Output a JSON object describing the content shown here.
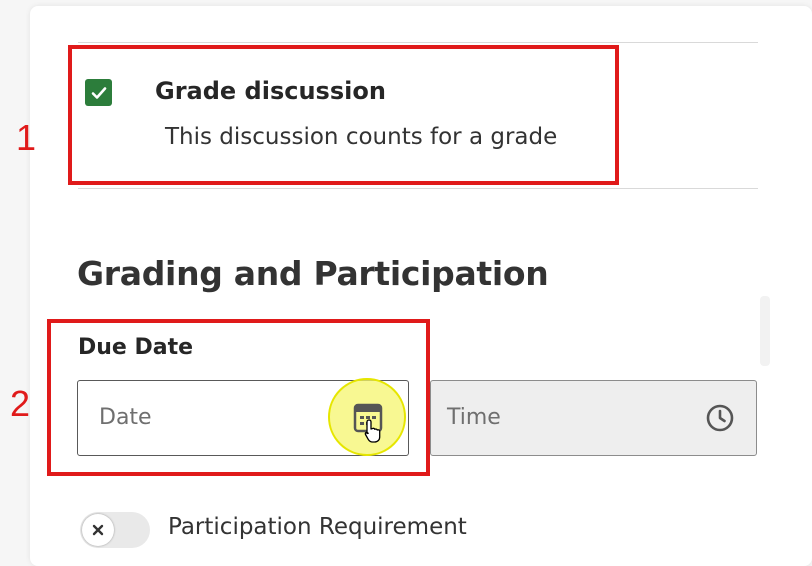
{
  "grade_discussion": {
    "checked": true,
    "title": "Grade discussion",
    "description": "This discussion counts for a grade"
  },
  "section": {
    "heading": "Grading and Participation"
  },
  "due_date": {
    "label": "Due Date",
    "date_placeholder": "Date",
    "time_placeholder": "Time"
  },
  "participation": {
    "toggle_on": false,
    "label": "Participation Requirement"
  },
  "annotations": {
    "first": "1",
    "second": "2"
  },
  "colors": {
    "accent_green": "#2c7d3b",
    "annotation_red": "#e01a1a",
    "click_highlight": "#f6f66e"
  },
  "icons": [
    "check-icon",
    "calendar-icon",
    "hand-cursor-icon",
    "clock-icon",
    "close-icon"
  ]
}
